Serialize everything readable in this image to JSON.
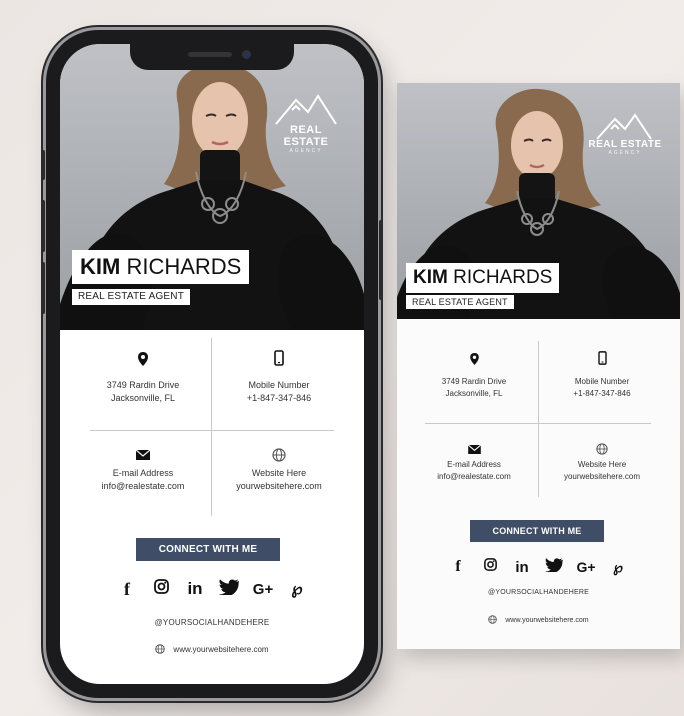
{
  "card": {
    "first_name": "KIM",
    "last_name": "RICHARDS",
    "title": "REAL ESTATE AGENT",
    "logo_line1": "REAL ESTATE",
    "logo_line2": "AGENCY",
    "address_line1": "3749  Rardin Drive",
    "address_line2": "Jacksonville, FL",
    "mobile_label": "Mobile Number",
    "mobile_value": "+1-847-347-846",
    "email_label": "E-mail Address",
    "email_value": "info@realestate.com",
    "website_label": "Website Here",
    "website_value": "yourwebsitehere.com",
    "connect_label": "CONNECT WITH ME",
    "social_handle": "@YOURSOCIALHANDEHERE",
    "footer_website": "www.yourwebsitehere.com",
    "socials": [
      "f",
      "◎",
      "in",
      "🐦",
      "G+",
      "℘"
    ]
  },
  "colors": {
    "button": "#3f4d66",
    "photo_bg": "#a9acb1",
    "background": "#ece6e3"
  },
  "icons": [
    "location-pin-icon",
    "mobile-phone-icon",
    "envelope-icon",
    "globe-icon",
    "facebook-icon",
    "instagram-icon",
    "linkedin-icon",
    "twitter-icon",
    "google-plus-icon",
    "pinterest-icon"
  ]
}
